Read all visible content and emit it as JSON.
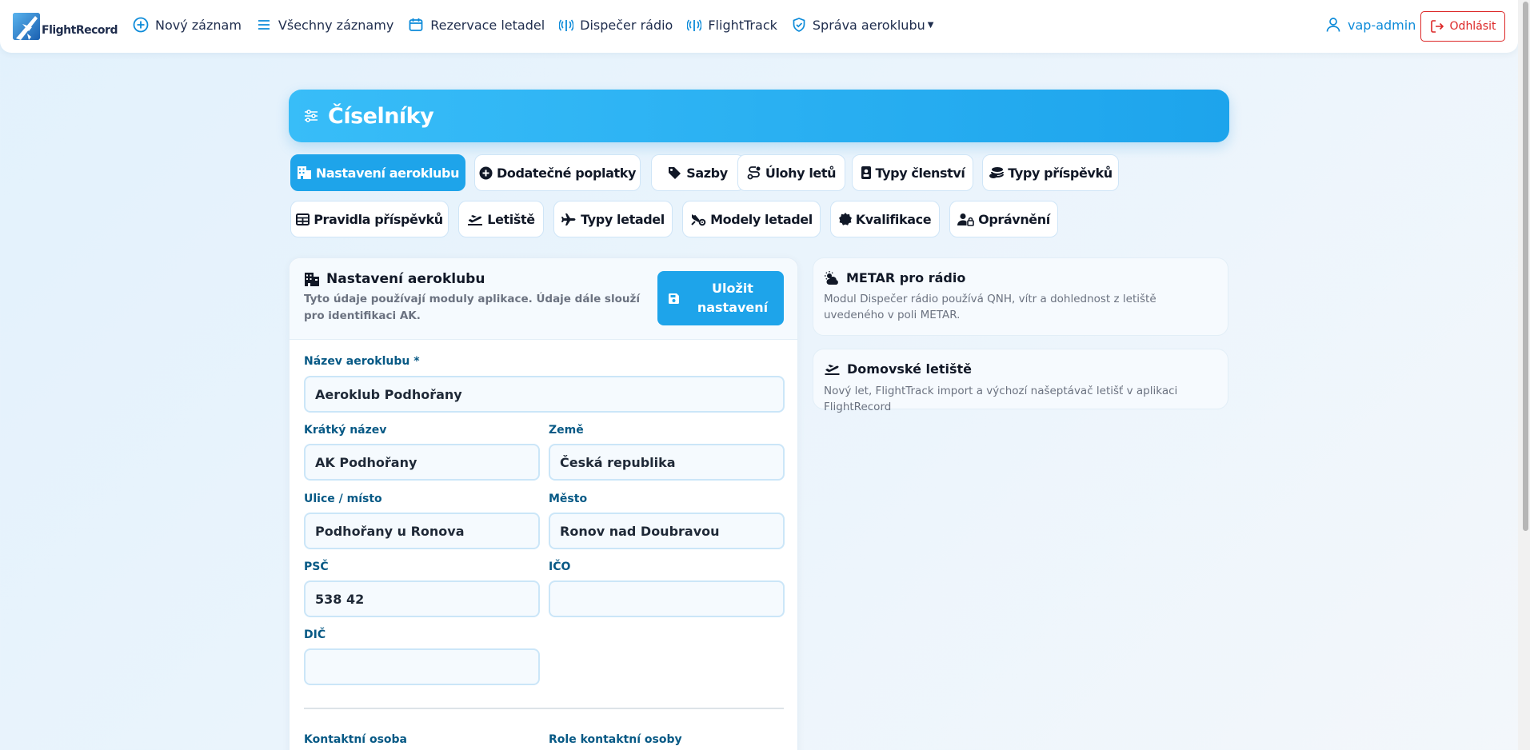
{
  "nav": {
    "brand": "FlightRecord",
    "items": [
      {
        "label": "Nový záznam",
        "icon": "plus-circle-icon"
      },
      {
        "label": "Všechny záznamy",
        "icon": "list-icon"
      },
      {
        "label": "Rezervace letadel",
        "icon": "calendar-icon"
      },
      {
        "label": "Dispečer rádio",
        "icon": "radio-icon"
      },
      {
        "label": "FlightTrack",
        "icon": "radio-icon"
      },
      {
        "label": "Správa aeroklubu",
        "icon": "shield-icon"
      }
    ],
    "user": "vap-admin",
    "logout": "Odhlásit"
  },
  "page": {
    "title": "Číselníky"
  },
  "tabs": [
    {
      "label": "Nastavení aeroklubu",
      "icon": "building-icon",
      "active": true
    },
    {
      "label": "Dodatečné poplatky",
      "icon": "plus-circle-icon"
    },
    {
      "label": "Sazby",
      "icon": "tags-icon"
    },
    {
      "label": "Úlohy letů",
      "icon": "route-icon"
    },
    {
      "label": "Typy členství",
      "icon": "id-card-icon"
    },
    {
      "label": "Typy příspěvků",
      "icon": "coins-icon"
    },
    {
      "label": "Pravidla příspěvků",
      "icon": "table-icon"
    },
    {
      "label": "Letiště",
      "icon": "plane-departure-icon"
    },
    {
      "label": "Typy letadel",
      "icon": "plane-icon"
    },
    {
      "label": "Modely letadel",
      "icon": "plane-gear-icon"
    },
    {
      "label": "Kvalifikace",
      "icon": "certificate-icon"
    },
    {
      "label": "Oprávnění",
      "icon": "user-lock-icon"
    }
  ],
  "settings": {
    "title": "Nastavení aeroklubu",
    "description": "Tyto údaje používají moduly aplikace. Údaje dále slouží pro identifikaci AK.",
    "save_label": "Uložit nastavení",
    "fields": {
      "name": {
        "label": "Název aeroklubu *",
        "value": "Aeroklub Podhořany"
      },
      "short_name": {
        "label": "Krátký název",
        "value": "AK Podhořany"
      },
      "country": {
        "label": "Země",
        "value": "Česká republika"
      },
      "street": {
        "label": "Ulice / místo",
        "value": "Podhořany u Ronova"
      },
      "city": {
        "label": "Město",
        "value": "Ronov nad Doubravou"
      },
      "zip": {
        "label": "PSČ",
        "value": "538 42"
      },
      "ico": {
        "label": "IČO",
        "value": ""
      },
      "dic": {
        "label": "DIČ",
        "value": ""
      },
      "contact_person": {
        "label": "Kontaktní osoba"
      },
      "contact_role": {
        "label": "Role kontaktní osoby"
      }
    }
  },
  "info": {
    "metar": {
      "title": "METAR pro rádio",
      "description": "Modul Dispečer rádio používá QNH, vítr a dohlednost z letiště uvedeného v poli METAR."
    },
    "home": {
      "title": "Domovské letiště",
      "description": "Nový let, FlightTrack import a výchozí našeptávač letišť v aplikaci FlightRecord"
    }
  },
  "colors": {
    "accent": "#1ea4ea",
    "label": "#075985",
    "danger": "#dc2626"
  }
}
